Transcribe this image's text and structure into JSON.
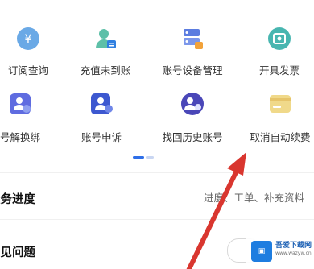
{
  "services": [
    {
      "label": "订阅查询",
      "icon": "yen-coin-icon",
      "color": "#6aa9e6"
    },
    {
      "label": "充值未到账",
      "icon": "user-card-icon",
      "color": "#5ec0a8"
    },
    {
      "label": "账号设备管理",
      "icon": "server-devices-icon",
      "color": "#5b7ce0"
    },
    {
      "label": "开具发票",
      "icon": "ticket-icon",
      "color": "#48b6b0"
    },
    {
      "label": "号解换绑",
      "icon": "user-heart-icon",
      "color": "#5f6ce0"
    },
    {
      "label": "账号申诉",
      "icon": "user-badge-icon",
      "color": "#3d58d0"
    },
    {
      "label": "找回历史账号",
      "icon": "users-history-icon",
      "color": "#4a47b8"
    },
    {
      "label": "取消自动续费",
      "icon": "card-cancel-icon",
      "color": "#f0d98a"
    }
  ],
  "pager": {
    "active_color": "#2f6fe8",
    "inactive_color": "#c9d6f2"
  },
  "service_progress": {
    "title": "服务进度",
    "subtitle": "进度、工单、补充资料"
  },
  "faq": {
    "title": "常见问题"
  },
  "watermark": {
    "name": "吾爱下载网",
    "sub": "www.wazyw.cn"
  },
  "accent": {
    "arrow": "#d9362f"
  }
}
